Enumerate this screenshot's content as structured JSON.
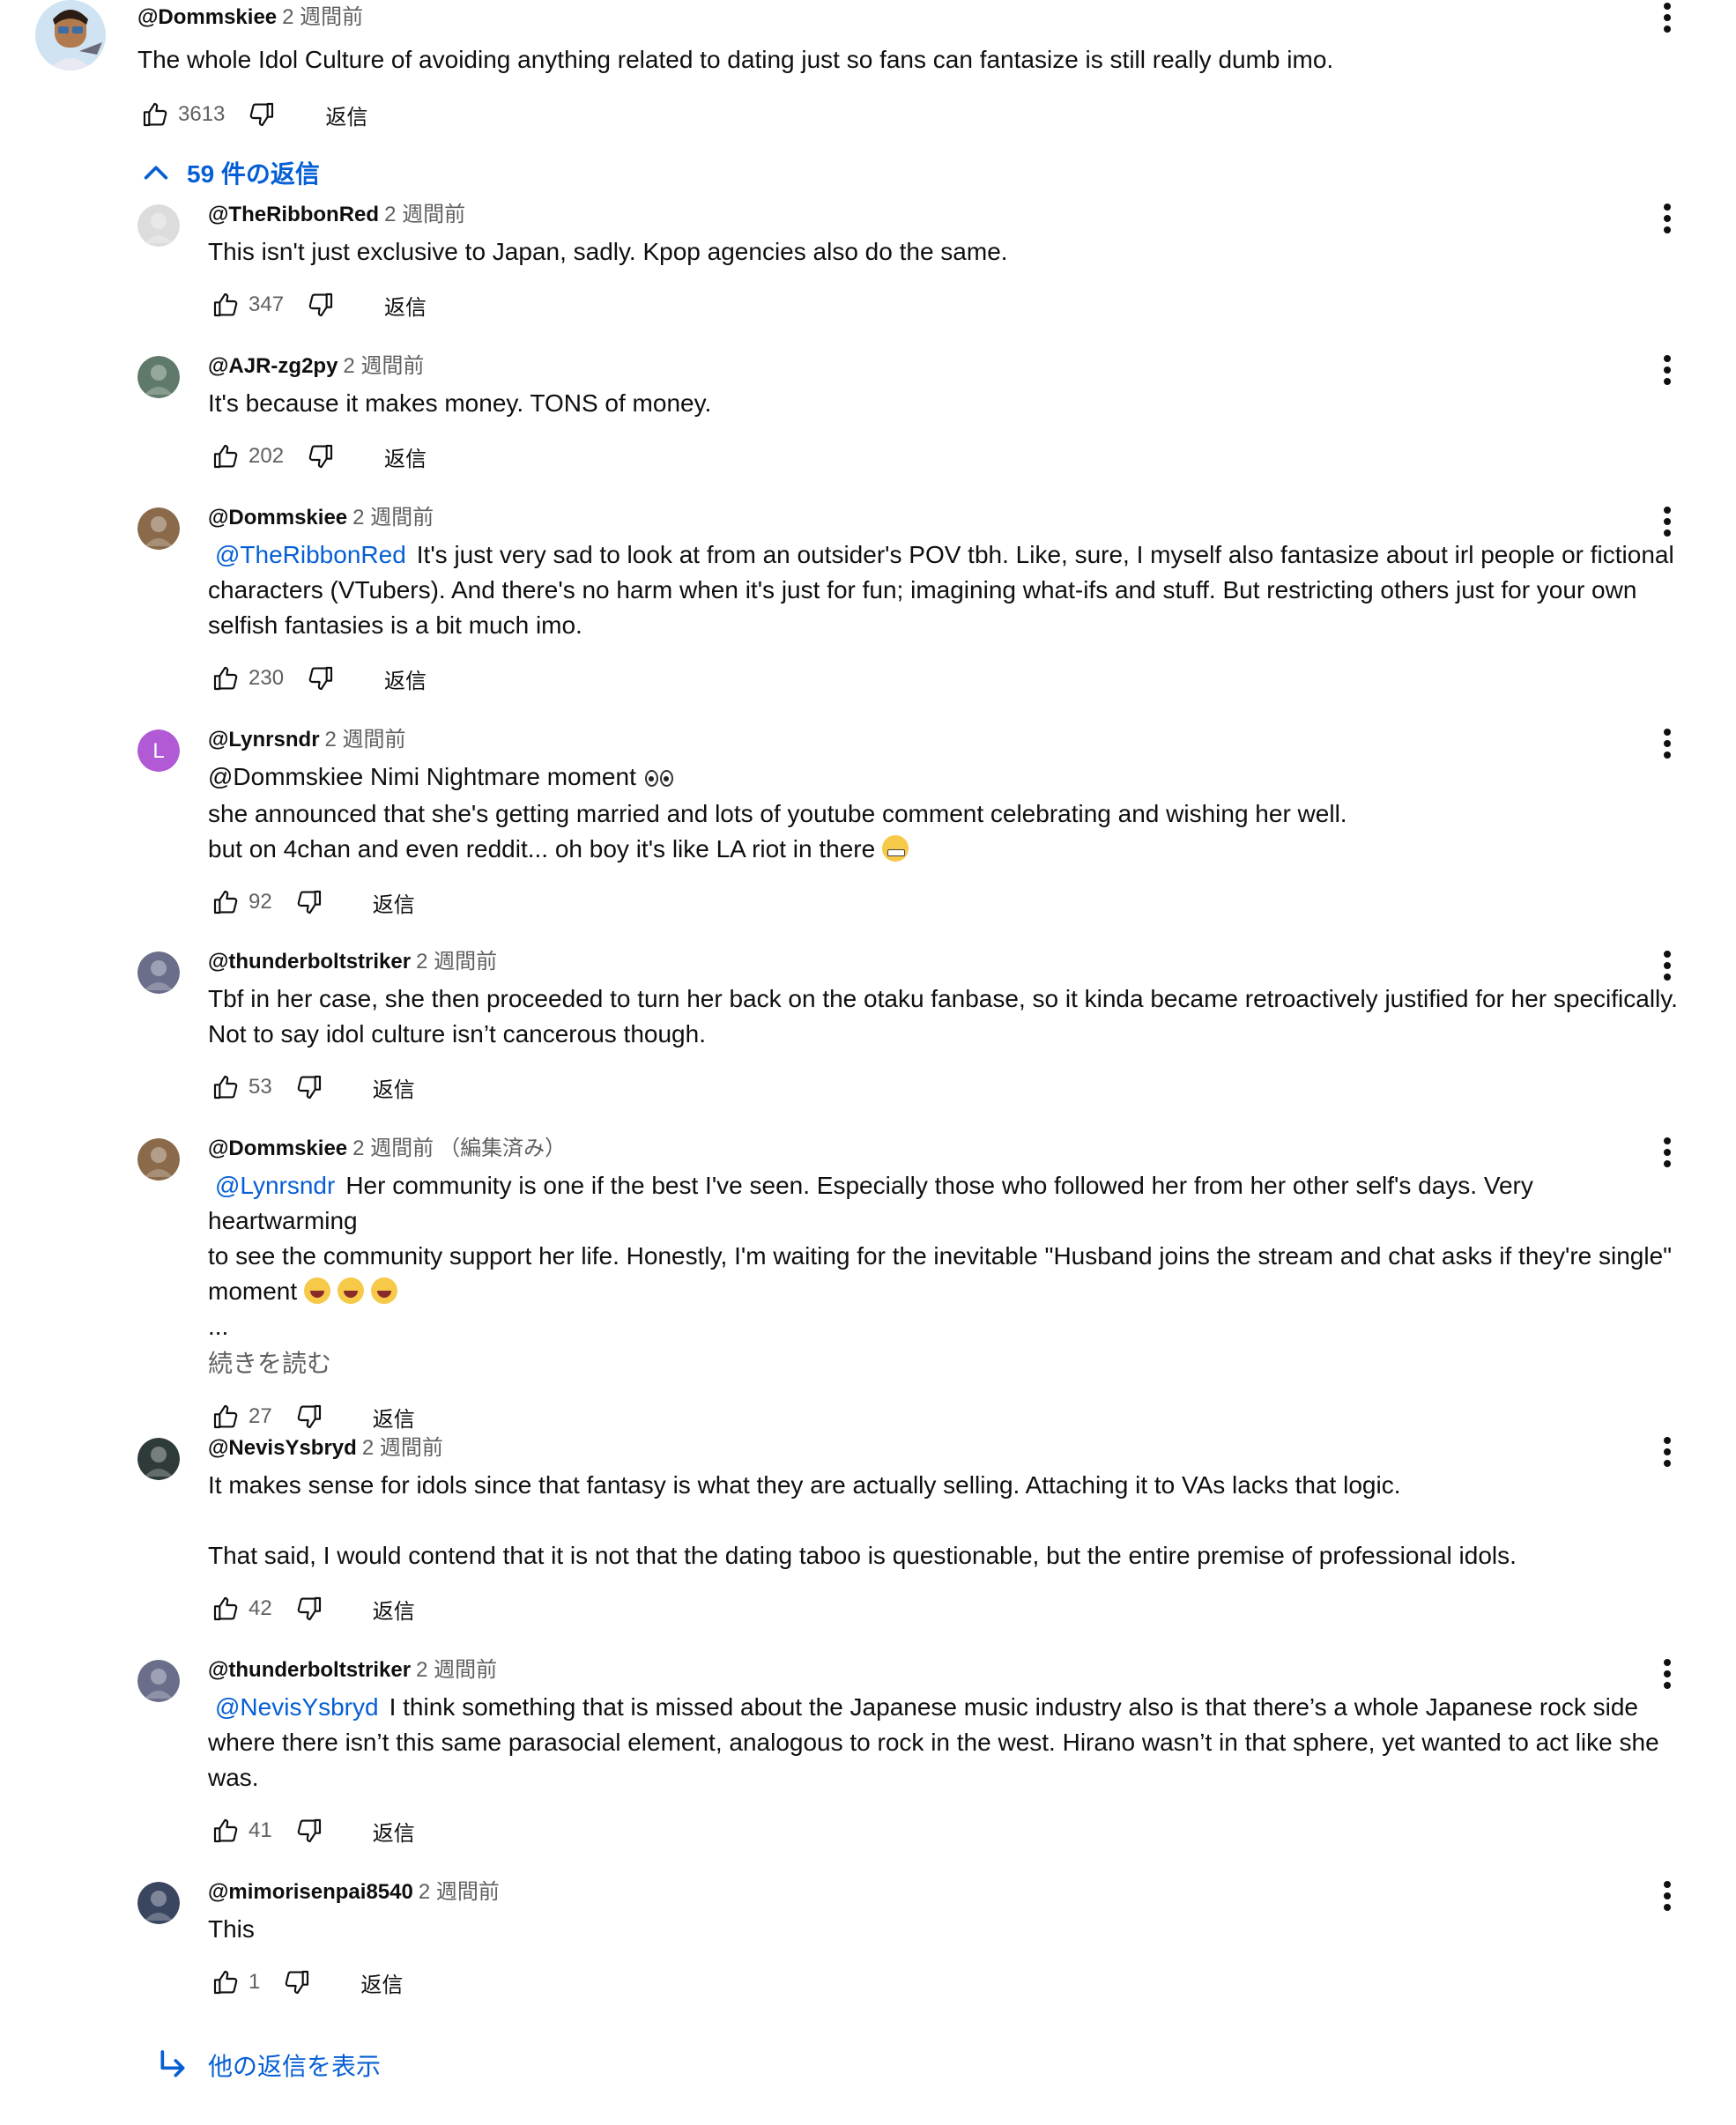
{
  "labels": {
    "reply": "返信",
    "read_more": "続きを読む",
    "replies_toggle": "59 件の返信",
    "show_more_replies": "他の返信を表示",
    "edited": "（編集済み）"
  },
  "top_comment": {
    "author": "@Dommskiee",
    "time": "2 週間前",
    "text": "The whole Idol Culture of avoiding anything related to dating just so fans can fantasize is still really dumb imo.",
    "likes": "3613"
  },
  "replies": [
    {
      "author": "@TheRibbonRed",
      "time": "2 週間前",
      "lines": [
        "This isn't just exclusive to Japan, sadly. Kpop agencies also do the same."
      ],
      "likes": "347",
      "avatar_color": "#dcdcdc"
    },
    {
      "author": "@AJR-zg2py",
      "time": "2 週間前",
      "lines": [
        "It's because it makes money. TONS of money."
      ],
      "likes": "202",
      "avatar_color": "#5f7a6a"
    },
    {
      "author": "@Dommskiee",
      "time": "2 週間前",
      "mention": "@TheRibbonRed",
      "lines": [
        "It's just very sad to look at from an outsider's POV tbh. Like, sure, I myself also fantasize about irl people or fictional",
        "characters (VTubers). And there's no harm when it's just for fun; imagining what-ifs and stuff. But restricting others just for your own",
        "selfish fantasies is a bit much imo."
      ],
      "likes": "230",
      "avatar_color": "#8a6a4a"
    },
    {
      "author": "@Lynrsndr",
      "time": "2 週間前",
      "lines": [
        "@Dommskiee Nimi Nightmare moment",
        "she announced that she's getting married and lots of youtube comment celebrating and wishing her well.",
        "but on 4chan and even reddit... oh boy it's like LA riot in there"
      ],
      "likes": "92",
      "avatar_letter": "L",
      "avatar_color": "#b25ad6"
    },
    {
      "author": "@thunderboltstriker",
      "time": "2 週間前",
      "lines": [
        "Tbf in her case, she then proceeded to turn her back on the otaku fanbase, so it kinda became retroactively justified for her specifically.",
        "Not to say idol culture isn’t cancerous though."
      ],
      "likes": "53",
      "avatar_color": "#6a6e8a"
    },
    {
      "author": "@Dommskiee",
      "time": "2 週間前",
      "edited": true,
      "mention": "@Lynrsndr",
      "lines": [
        "Her community is one if the best I've seen. Especially those who followed her from her other self's days. Very heartwarming",
        "to see the community support her life. Honestly, I'm waiting for the inevitable \"Husband joins the stream and chat asks if they're single\"",
        "moment",
        "..."
      ],
      "likes": "27",
      "avatar_color": "#8a6a4a"
    },
    {
      "author": "@NevisYsbryd",
      "time": "2 週間前",
      "lines": [
        "It makes sense for idols since that fantasy is what they are actually selling. Attaching it to VAs lacks that logic.",
        "",
        "That said, I would contend that it is not that the dating taboo is questionable, but the entire premise of professional idols."
      ],
      "likes": "42",
      "avatar_color": "#2f3a3a"
    },
    {
      "author": "@thunderboltstriker",
      "time": "2 週間前",
      "mention": "@NevisYsbryd",
      "lines": [
        "I think something that is missed about the Japanese music industry also is that there’s a whole Japanese rock side",
        "where there isn’t this same parasocial element, analogous to rock in the west. Hirano wasn’t in that sphere, yet wanted to act like she",
        "was."
      ],
      "likes": "41",
      "avatar_color": "#6a6e8a"
    },
    {
      "author": "@mimorisenpai8540",
      "time": "2 週間前",
      "lines": [
        "This"
      ],
      "likes": "1",
      "avatar_color": "#3a4660"
    }
  ]
}
